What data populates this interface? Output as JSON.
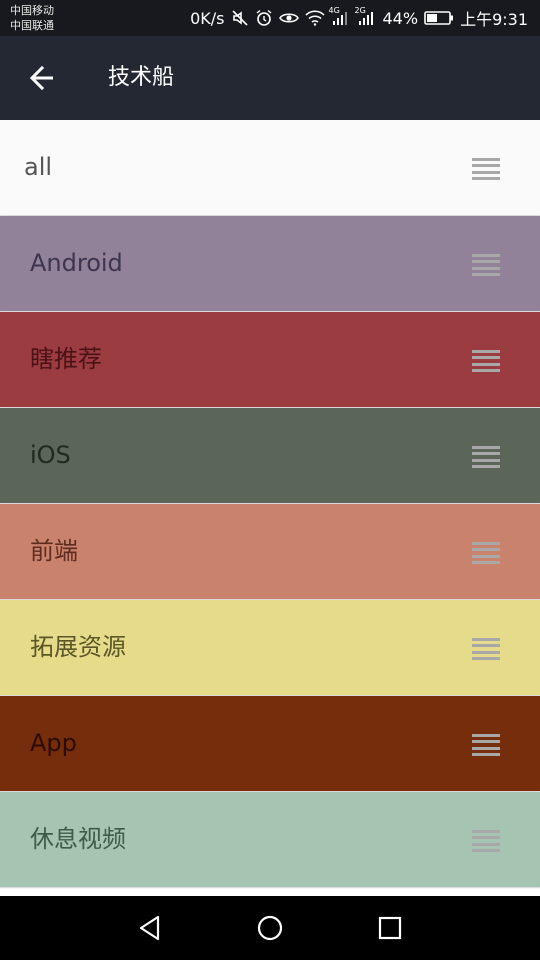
{
  "status_bar": {
    "carrier_1": "中国移动",
    "carrier_2": "中国联通",
    "network_speed": "0K/s",
    "signal_label_1": "4G",
    "signal_label_2": "2G",
    "battery_percent": "44%",
    "time": "上午9:31"
  },
  "toolbar": {
    "title": "技术船",
    "back_icon": "arrow-left-icon"
  },
  "channels": [
    {
      "label": "all",
      "bg": "#fafafa",
      "text_color": "#555555"
    },
    {
      "label": "Android",
      "bg": "#918299",
      "text_color": "#3d3550"
    },
    {
      "label": "瞎推荐",
      "bg": "#9b3c40",
      "text_color": "#4a1214"
    },
    {
      "label": "iOS",
      "bg": "#5b6558",
      "text_color": "#23291f"
    },
    {
      "label": "前端",
      "bg": "#c9826c",
      "text_color": "#5e2c1f"
    },
    {
      "label": "拓展资源",
      "bg": "#e5db8a",
      "text_color": "#5c5626"
    },
    {
      "label": "App",
      "bg": "#762d0c",
      "text_color": "#2c0c00"
    },
    {
      "label": "休息视频",
      "bg": "#a5c5b2",
      "text_color": "#3e5a4a"
    }
  ],
  "navigation": {
    "back_icon": "triangle-back-icon",
    "home_icon": "circle-home-icon",
    "recents_icon": "square-recents-icon"
  },
  "colors": {
    "status_bar_bg": "#17191e",
    "toolbar_bg": "#232833",
    "handle_color": "#a8a8a8",
    "nav_bar_bg": "#000000"
  }
}
